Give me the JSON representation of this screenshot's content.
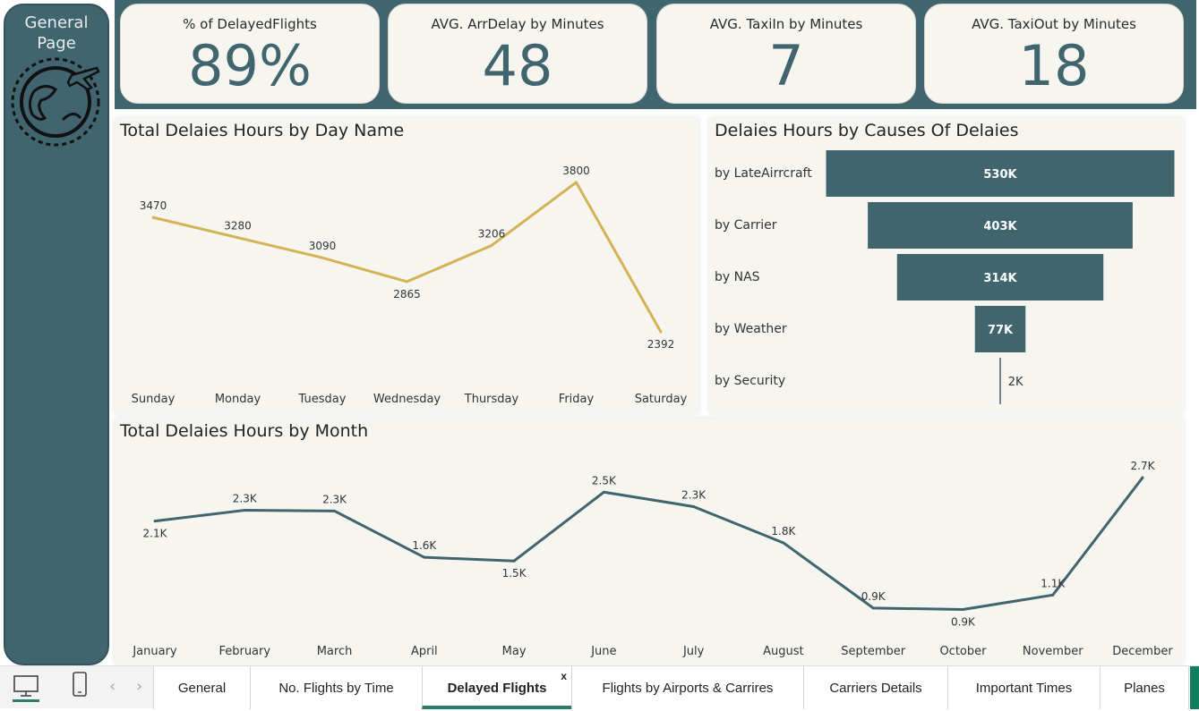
{
  "sidebar": {
    "title": "General Page"
  },
  "kpis": [
    {
      "label": "% of DelayedFlights",
      "value": "89%"
    },
    {
      "label": "AVG. ArrDelay by Minutes",
      "value": "48"
    },
    {
      "label": "AVG. TaxiIn by Minutes",
      "value": "7"
    },
    {
      "label": "AVG. TaxiOut by Minutes",
      "value": "18"
    }
  ],
  "colors": {
    "primary": "#41656e",
    "line_gold": "#d4b255",
    "panel_bg": "#f6f5f0",
    "active_tab": "#2e7d6b"
  },
  "chart_data": [
    {
      "type": "line",
      "title": "Total Delaies Hours by Day Name",
      "categories": [
        "Sunday",
        "Monday",
        "Tuesday",
        "Wednesday",
        "Thursday",
        "Friday",
        "Saturday"
      ],
      "values": [
        3470,
        3280,
        3090,
        2865,
        3206,
        3800,
        2392
      ],
      "labels": [
        "3470",
        "3280",
        "3090",
        "2865",
        "3206",
        "3800",
        "2392"
      ],
      "ylim": [
        2300,
        3850
      ]
    },
    {
      "type": "bar",
      "title": "Delaies Hours by Causes Of Delaies",
      "categories": [
        "by LateAirrcraft",
        "by Carrier",
        "by NAS",
        "by Weather",
        "by Security"
      ],
      "values": [
        530,
        403,
        314,
        77,
        2
      ],
      "labels": [
        "530K",
        "403K",
        "314K",
        "77K",
        "2K"
      ],
      "unit": "K"
    },
    {
      "type": "line",
      "title": "Total Delaies Hours by Month",
      "categories": [
        "January",
        "February",
        "March",
        "April",
        "May",
        "June",
        "July",
        "August",
        "September",
        "October",
        "November",
        "December"
      ],
      "values": [
        2.1,
        2.25,
        2.24,
        1.6,
        1.55,
        2.5,
        2.3,
        1.8,
        0.9,
        0.88,
        1.08,
        2.7
      ],
      "labels": [
        "2.1K",
        "2.3K",
        "2.3K",
        "1.6K",
        "1.5K",
        "2.5K",
        "2.3K",
        "1.8K",
        "0.9K",
        "0.9K",
        "1.1K",
        "2.7K"
      ],
      "ylim": [
        0.8,
        2.75
      ]
    }
  ],
  "tabs": [
    {
      "label": "General"
    },
    {
      "label": "No. Flights by Time"
    },
    {
      "label": "Delayed Flights",
      "active": true
    },
    {
      "label": "Flights by Airports & Carrires"
    },
    {
      "label": "Carriers Details"
    },
    {
      "label": "Important Times"
    },
    {
      "label": "Planes"
    }
  ],
  "tab_close": "x",
  "nav": {
    "prev": "‹",
    "next": "›"
  }
}
